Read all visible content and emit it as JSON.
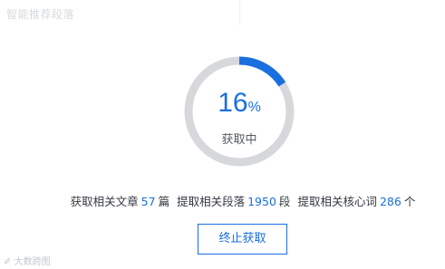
{
  "header": {
    "title": "智能推荐段落"
  },
  "progress": {
    "percent": 16,
    "percent_value": "16",
    "percent_unit": "%",
    "status": "获取中",
    "track_color": "#d6d8dc",
    "fill_color": "#1a6fe0"
  },
  "stats": {
    "articles_prefix": "获取相关文章",
    "articles_count": "57",
    "articles_unit": "篇",
    "paragraphs_prefix": "提取相关段落",
    "paragraphs_count": "1950",
    "paragraphs_unit": "段",
    "keywords_prefix": "提取相关核心词",
    "keywords_count": "286",
    "keywords_unit": "个"
  },
  "actions": {
    "stop_label": "终止获取"
  },
  "watermark": {
    "icon": "link-icon",
    "text": "大数跨图"
  },
  "colors": {
    "accent": "#1a6fe0",
    "text": "#333840",
    "muted": "#d6d9de"
  }
}
